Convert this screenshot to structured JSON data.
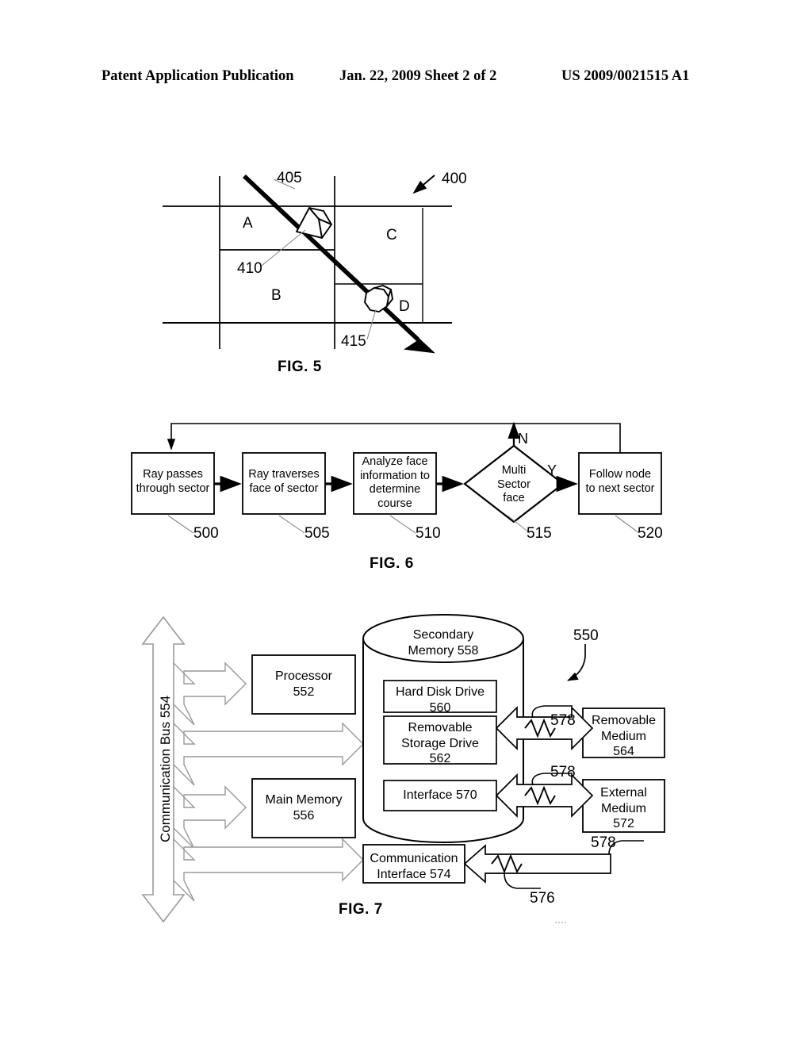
{
  "header": {
    "left": "Patent Application Publication",
    "center": "Jan. 22, 2009  Sheet 2 of 2",
    "right": "US 2009/0021515 A1"
  },
  "fig5": {
    "caption": "FIG. 5",
    "sectors": [
      "A",
      "B",
      "C",
      "D"
    ],
    "refs": {
      "ray": "405",
      "scene": "400",
      "prism_object": "410",
      "octagon_object": "415"
    }
  },
  "fig6": {
    "caption": "FIG. 6",
    "steps": [
      {
        "ref": "500",
        "text": "Ray passes\nthrough sector"
      },
      {
        "ref": "505",
        "text": "Ray traverses\nface of sector"
      },
      {
        "ref": "510",
        "text": "Analyze face\ninformation to\ndetermine\ncourse"
      },
      {
        "ref": "515",
        "text": "Multi\nSector\nface"
      },
      {
        "ref": "520",
        "text": "Follow node\nto next sector"
      }
    ],
    "step_labels": {
      "s500_line1": "Ray passes",
      "s500_line2": "through sector",
      "s505_line1": "Ray traverses",
      "s505_line2": "face of sector",
      "s510_line1": "Analyze face",
      "s510_line2": "information to",
      "s510_line3": "determine",
      "s510_line4": "course",
      "s515_line1": "Multi",
      "s515_line2": "Sector",
      "s515_line3": "face",
      "s520_line1": "Follow node",
      "s520_line2": "to next sector"
    },
    "branch_yes": "Y",
    "branch_no": "N",
    "refs": [
      "500",
      "505",
      "510",
      "515",
      "520"
    ]
  },
  "fig7": {
    "caption": "FIG. 7",
    "system_ref": "550",
    "bus_label": "Communication Bus 554",
    "blocks": {
      "processor_line1": "Processor",
      "processor_line2": "552",
      "main_memory_line1": "Main Memory",
      "main_memory_line2": "556",
      "secondary_memory_line1": "Secondary",
      "secondary_memory_line2": "Memory 558",
      "hard_disk_line1": "Hard Disk Drive",
      "hard_disk_line2": "560",
      "removable_drive_line1": "Removable",
      "removable_drive_line2": "Storage Drive",
      "removable_drive_line3": "562",
      "interface_570": "Interface 570",
      "removable_medium_line1": "Removable",
      "removable_medium_line2": "Medium",
      "removable_medium_line3": "564",
      "external_medium_line1": "External",
      "external_medium_line2": "Medium",
      "external_medium_line3": "572",
      "comm_interface_line1": "Communication",
      "comm_interface_line2": "Interface 574"
    },
    "refs": {
      "channel_a": "578",
      "channel_b": "578",
      "channel_c": "578",
      "signal_path": "576"
    }
  },
  "colors": {
    "ink": "#000000",
    "paper": "#ffffff",
    "bus_gray": "#9a9a9a",
    "leader_gray": "#9a9a9a"
  }
}
